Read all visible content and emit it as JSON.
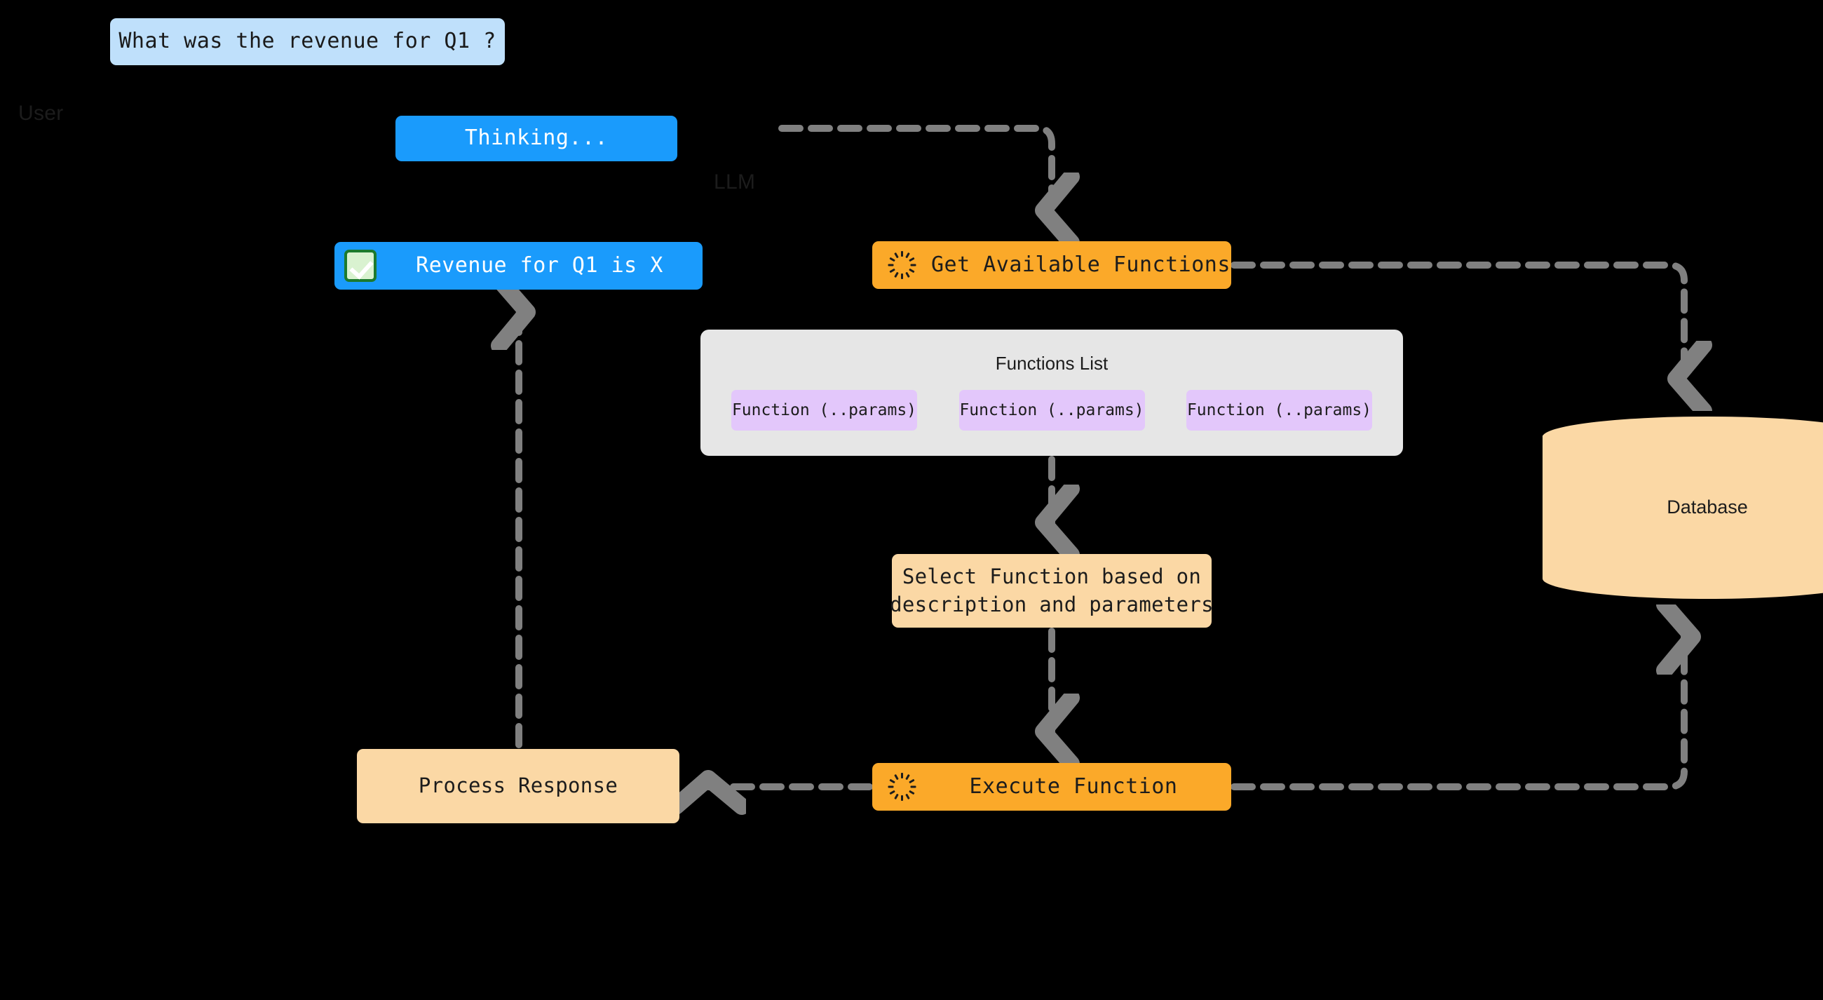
{
  "diagram": {
    "background_color": "#000000",
    "edge_color": "#808080",
    "lanes": [
      {
        "id": "user",
        "label": "User"
      },
      {
        "id": "llm",
        "label": "LLM"
      }
    ],
    "nodes": {
      "user_question": {
        "text": "What was the revenue for Q1 ?",
        "color": "#bfe0fb",
        "text_color": "#1a1a1a"
      },
      "thinking": {
        "text": "Thinking...",
        "color": "#1a9bfc",
        "text_color": "#ffffff"
      },
      "answer": {
        "text": "Revenue for Q1 is X",
        "icon": "check-mark-icon",
        "color": "#1a9bfc",
        "text_color": "#ffffff"
      },
      "get_functions": {
        "text": "Get Available Functions",
        "icon": "spinner-icon",
        "color": "#fba929",
        "text_color": "#1c1c1c"
      },
      "functions_list": {
        "title": "Functions List",
        "color": "#e6e6e6",
        "chip_color": "#e3c7fb",
        "items": [
          "Function (..params)",
          "Function (..params)",
          "Function (..params)"
        ]
      },
      "select_function": {
        "line1": "Select Function based on",
        "line2": "description and parameters",
        "color": "#fbd8a5",
        "text_color": "#1c1c1c"
      },
      "execute_function": {
        "text": "Execute Function",
        "icon": "spinner-icon",
        "color": "#fba929",
        "text_color": "#1c1c1c"
      },
      "process_response": {
        "text": "Process Response",
        "color": "#fbd8a5",
        "text_color": "#1c1c1c"
      },
      "database": {
        "text": "Database",
        "color": "#fbd8a5",
        "text_color": "#1c1c1c"
      }
    },
    "edges": [
      {
        "from": "thinking",
        "to": "get_functions",
        "style": "dashed",
        "arrow": "end"
      },
      {
        "from": "get_functions",
        "to": "database",
        "style": "dashed",
        "arrow": "end"
      },
      {
        "from": "functions_list",
        "to": "select_function",
        "style": "dashed",
        "arrow": "end"
      },
      {
        "from": "select_function",
        "to": "execute_function",
        "style": "dashed",
        "arrow": "end"
      },
      {
        "from": "execute_function",
        "to": "database",
        "style": "dashed",
        "arrow": "end"
      },
      {
        "from": "execute_function",
        "to": "process_response",
        "style": "dashed",
        "arrow": "end"
      },
      {
        "from": "process_response",
        "to": "answer",
        "style": "dashed",
        "arrow": "end"
      }
    ]
  }
}
